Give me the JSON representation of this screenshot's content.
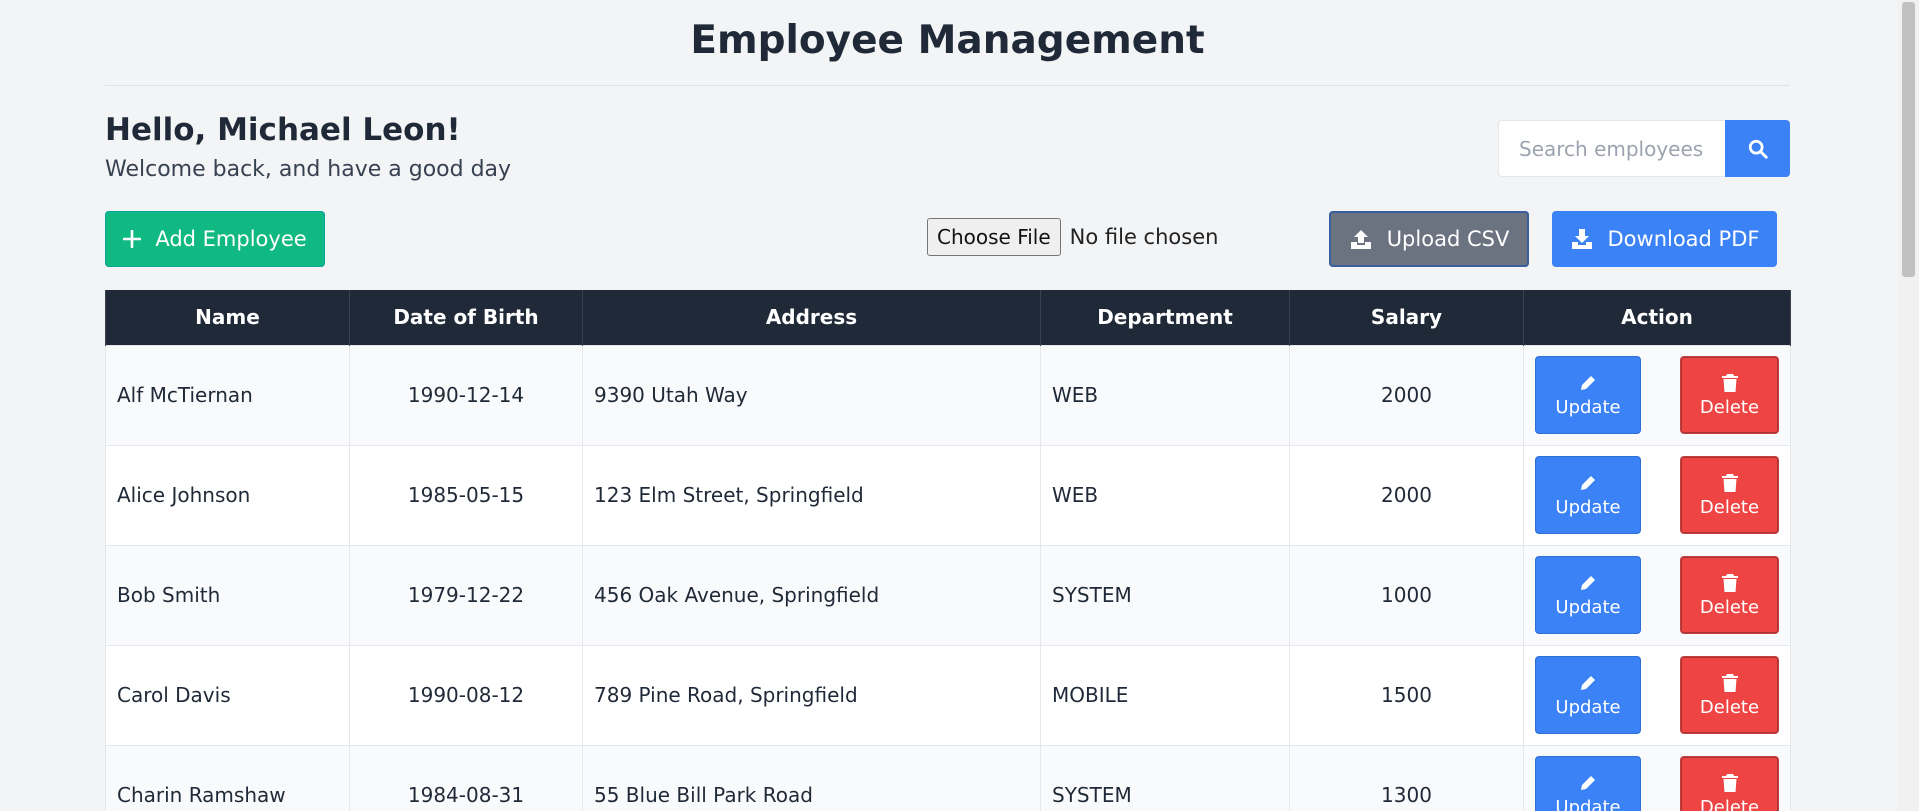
{
  "header": {
    "title": "Employee Management"
  },
  "greeting": {
    "hello": "Hello, Michael Leon!",
    "welcome": "Welcome back, and have a good day"
  },
  "search": {
    "placeholder": "Search employees..."
  },
  "toolbar": {
    "add_label": "Add Employee",
    "choose_file_label": "Choose File",
    "file_status": "No file chosen",
    "upload_label": "Upload CSV",
    "download_label": "Download PDF"
  },
  "table": {
    "headers": [
      "Name",
      "Date of Birth",
      "Address",
      "Department",
      "Salary",
      "Action"
    ],
    "update_label": "Update",
    "delete_label": "Delete",
    "rows": [
      {
        "name": "Alf McTiernan",
        "dob": "1990-12-14",
        "address": "9390 Utah Way",
        "department": "WEB",
        "salary": "2000"
      },
      {
        "name": "Alice Johnson",
        "dob": "1985-05-15",
        "address": "123 Elm Street, Springfield",
        "department": "WEB",
        "salary": "2000"
      },
      {
        "name": "Bob Smith",
        "dob": "1979-12-22",
        "address": "456 Oak Avenue, Springfield",
        "department": "SYSTEM",
        "salary": "1000"
      },
      {
        "name": "Carol Davis",
        "dob": "1990-08-12",
        "address": "789 Pine Road, Springfield",
        "department": "MOBILE",
        "salary": "1500"
      },
      {
        "name": "Charin Ramshaw",
        "dob": "1984-08-31",
        "address": "55 Blue Bill Park Road",
        "department": "SYSTEM",
        "salary": "1300"
      }
    ]
  },
  "colors": {
    "primary": "#3b82f6",
    "success": "#10b981",
    "danger": "#ef4444",
    "secondary": "#6b7280",
    "header_bg": "#1f2937"
  }
}
